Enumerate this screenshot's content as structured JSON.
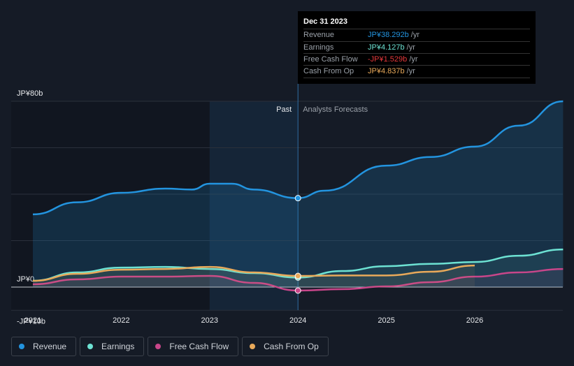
{
  "chart_data": {
    "type": "line",
    "y_axis_labels": [
      "JP¥80b",
      "JP¥0",
      "-JP¥10b"
    ],
    "ylim": [
      -10,
      80
    ],
    "xlim": [
      2021,
      2027
    ],
    "x_ticks": [
      "2021",
      "2022",
      "2023",
      "2024",
      "2025",
      "2026"
    ],
    "past_label": "Past",
    "forecast_label": "Analysts Forecasts",
    "divider_x": 2024,
    "series": [
      {
        "name": "Revenue",
        "color": "#2394df",
        "x": [
          2021,
          2021.5,
          2022,
          2022.5,
          2022.8,
          2023,
          2023.25,
          2023.5,
          2024,
          2024.3,
          2025,
          2025.5,
          2026,
          2026.5,
          2027
        ],
        "values": [
          31.3,
          36.5,
          40.6,
          42.4,
          42,
          44.5,
          44.5,
          42,
          38.3,
          41.5,
          52.3,
          56,
          60.5,
          69.5,
          80
        ]
      },
      {
        "name": "Earnings",
        "color": "#6de2d3",
        "x": [
          2021,
          2021.5,
          2022,
          2022.5,
          2023,
          2023.5,
          2024,
          2024.5,
          2025,
          2025.5,
          2026,
          2026.5,
          2027
        ],
        "values": [
          2.7,
          6.3,
          8.4,
          8.7,
          7.8,
          6,
          4.1,
          6.9,
          9,
          10,
          10.8,
          13.5,
          16.2
        ]
      },
      {
        "name": "Free Cash Flow",
        "color": "#c8468a",
        "x": [
          2021,
          2021.5,
          2022,
          2022.5,
          2023,
          2023.5,
          2024,
          2024.5,
          2025,
          2025.5,
          2026,
          2026.5,
          2027
        ],
        "values": [
          1.2,
          3.3,
          4.5,
          4.5,
          4.8,
          1.8,
          -1.5,
          -0.9,
          0.3,
          2.1,
          4.5,
          6.3,
          7.8
        ]
      },
      {
        "name": "Cash From Op",
        "color": "#e8a95a",
        "x": [
          2021,
          2021.5,
          2022,
          2022.5,
          2023,
          2023.5,
          2024,
          2024.5,
          2025,
          2025.5,
          2026
        ],
        "values": [
          2.7,
          5.7,
          7.5,
          7.8,
          8.7,
          6.3,
          4.8,
          5,
          5,
          6.6,
          9.3
        ]
      }
    ]
  },
  "tooltip": {
    "date": "Dec 31 2023",
    "rows": [
      {
        "label": "Revenue",
        "value": "JP¥38.292b",
        "unit": " /yr",
        "color": "#2394df"
      },
      {
        "label": "Earnings",
        "value": "JP¥4.127b",
        "unit": " /yr",
        "color": "#6de2d3"
      },
      {
        "label": "Free Cash Flow",
        "value": "-JP¥1.529b",
        "unit": " /yr",
        "color": "#e5383b"
      },
      {
        "label": "Cash From Op",
        "value": "JP¥4.837b",
        "unit": " /yr",
        "color": "#e8a95a"
      }
    ]
  }
}
